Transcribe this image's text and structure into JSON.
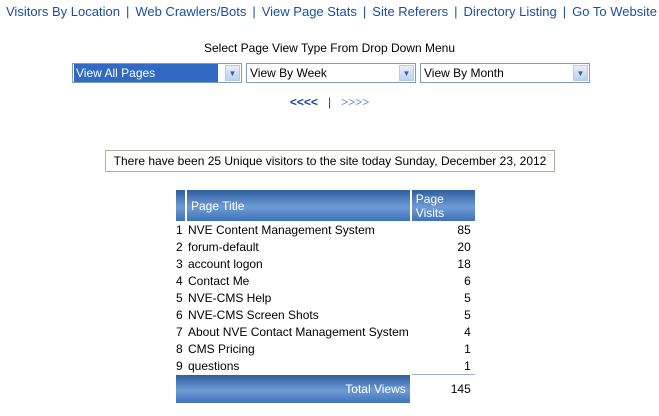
{
  "nav": {
    "items": [
      {
        "label": "Visitors By Location"
      },
      {
        "label": "Web Crawlers/Bots"
      },
      {
        "label": "View Page Stats"
      },
      {
        "label": "Site Referers"
      },
      {
        "label": "Directory Listing"
      },
      {
        "label": "Go To Website"
      }
    ],
    "separator": "|"
  },
  "instruction": "Select Page View Type From Drop Down Menu",
  "filters": {
    "page_type": "View All Pages",
    "week": "View By Week",
    "month": "View By Month"
  },
  "pager": {
    "prev": "<<<<",
    "separator": "|",
    "next": ">>>>"
  },
  "notice": "There have been 25 Unique visitors to the site today Sunday, December 23, 2012",
  "table": {
    "headers": {
      "title": "Page Title",
      "visits": "Page Visits"
    },
    "rows": [
      {
        "num": "1",
        "title": "NVE Content Management System",
        "visits": "85"
      },
      {
        "num": "2",
        "title": "forum-default",
        "visits": "20"
      },
      {
        "num": "3",
        "title": "account logon",
        "visits": "18"
      },
      {
        "num": "4",
        "title": "Contact Me",
        "visits": "6"
      },
      {
        "num": "5",
        "title": "NVE-CMS Help",
        "visits": "5"
      },
      {
        "num": "6",
        "title": "NVE-CMS Screen Shots",
        "visits": "5"
      },
      {
        "num": "7",
        "title": "About NVE Contact Management System",
        "visits": "4"
      },
      {
        "num": "8",
        "title": "CMS Pricing",
        "visits": "1"
      },
      {
        "num": "9",
        "title": "questions",
        "visits": "1"
      }
    ],
    "total_label": "Total Views",
    "total_value": "145"
  }
}
